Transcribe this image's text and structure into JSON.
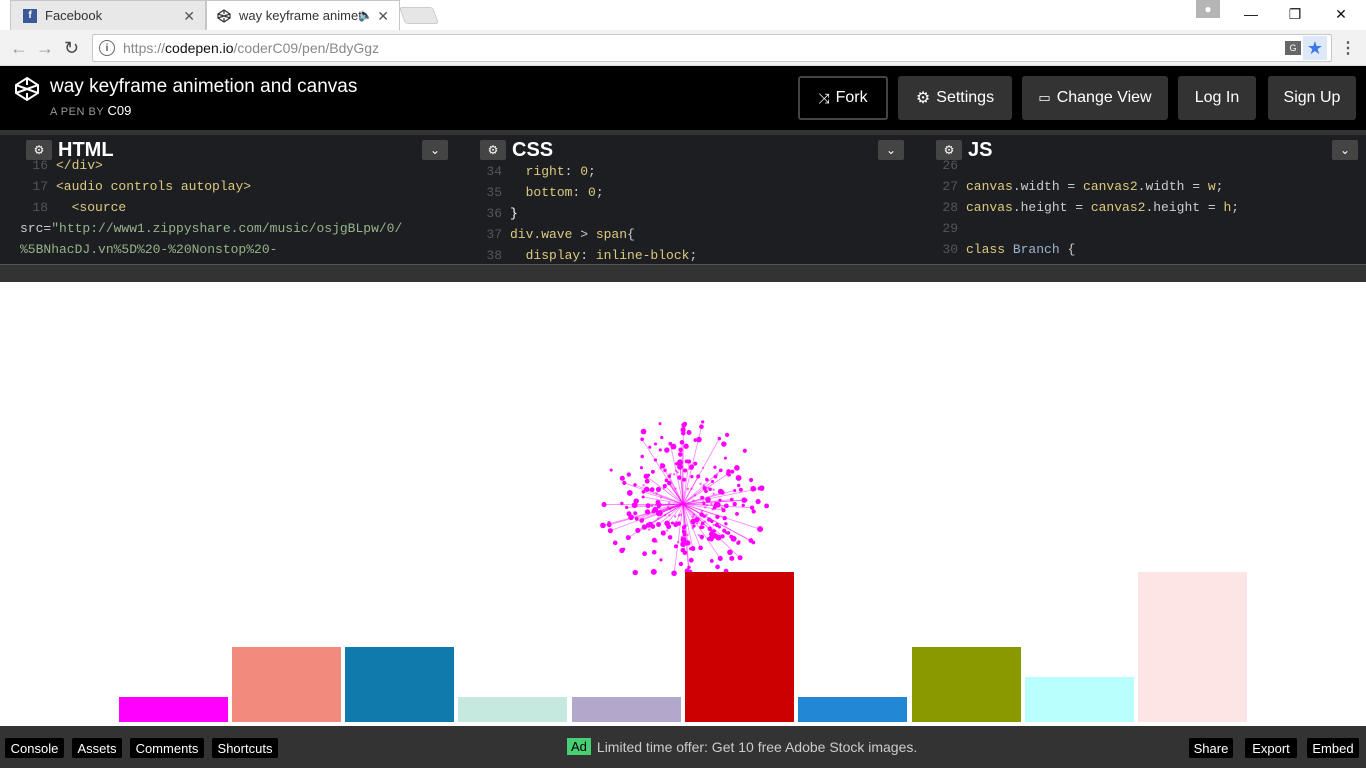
{
  "browser": {
    "tabs": [
      {
        "title": "Facebook",
        "favicon": "facebook-icon"
      },
      {
        "title": "way keyframe animetion and canvas",
        "favicon": "codepen-icon"
      }
    ],
    "url_scheme": "https://",
    "url_host": "codepen.io",
    "url_path": "/coderC09/pen/BdyGgz"
  },
  "header": {
    "title": "way keyframe animetion and canvas",
    "by_prefix": "A PEN BY",
    "author": "C09",
    "buttons": {
      "fork": "Fork",
      "settings": "Settings",
      "change_view": "Change View",
      "login": "Log In",
      "signup": "Sign Up"
    }
  },
  "editors": {
    "html": {
      "title": "HTML"
    },
    "css": {
      "title": "CSS"
    },
    "js": {
      "title": "JS"
    }
  },
  "footer": {
    "buttons": {
      "console": "Console",
      "assets": "Assets",
      "comments": "Comments",
      "shortcuts": "Shortcuts",
      "share": "Share",
      "export": "Export",
      "embed": "Embed"
    },
    "ad_badge": "Ad",
    "ad_text": "Limited time offer: Get 10 free Adobe Stock images."
  },
  "preview": {
    "bars": [
      {
        "color": "#ff00ff"
      },
      {
        "color": "#f28b7e"
      },
      {
        "color": "#117aac"
      },
      {
        "color": "#c5e8df"
      },
      {
        "color": "#b4a7cc"
      },
      {
        "color": "#cc0000"
      },
      {
        "color": "#2288d6"
      },
      {
        "color": "#889a00"
      },
      {
        "color": "#b8fffe"
      },
      {
        "color": "#fde5e5"
      }
    ],
    "dandelion_color": "#ff00ff"
  }
}
